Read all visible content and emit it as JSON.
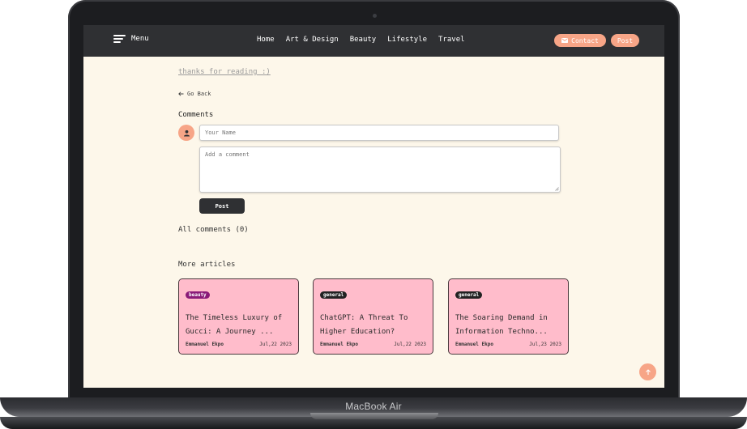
{
  "device": {
    "label": "MacBook Air"
  },
  "navbar": {
    "menu_label": "Menu",
    "links": [
      "Home",
      "Art & Design",
      "Beauty",
      "Lifestyle",
      "Travel"
    ],
    "contact_label": "Contact",
    "post_label": "Post"
  },
  "article": {
    "cut_text": "",
    "thanks_text": "thanks for reading :)",
    "go_back_label": "Go Back"
  },
  "comments": {
    "heading": "Comments",
    "name_placeholder": "Your Name",
    "comment_placeholder": "Add a comment",
    "post_label": "Post",
    "all_comments_label": "All comments (0)"
  },
  "more_articles": {
    "heading": "More articles",
    "cards": [
      {
        "category": "beauty",
        "category_color": "#8a1a78",
        "title_line1": "The Timeless Luxury of",
        "title_line2": "Gucci: A Journey ...",
        "author": "Emmanuel Ekpo",
        "date": "Jul,22 2023"
      },
      {
        "category": "general",
        "category_color": "#222222",
        "title_line1": "ChatGPT: A Threat To",
        "title_line2": "Higher Education?",
        "author": "Emmanuel Ekpo",
        "date": "Jul,22 2023"
      },
      {
        "category": "general",
        "category_color": "#222222",
        "title_line1": "The Soaring Demand in",
        "title_line2": "Information Techno...",
        "author": "Emmanuel Ekpo",
        "date": "Jul,23 2023"
      }
    ]
  },
  "colors": {
    "accent": "#f7a587",
    "navbar": "#2f3033",
    "page_bg": "#fdf7ea",
    "card_bg": "#ffbccb"
  },
  "icons": {
    "menu": "hamburger-icon",
    "contact": "mail-icon",
    "back": "arrow-left-icon",
    "avatar": "user-icon",
    "scroll_top": "arrow-up-icon"
  }
}
